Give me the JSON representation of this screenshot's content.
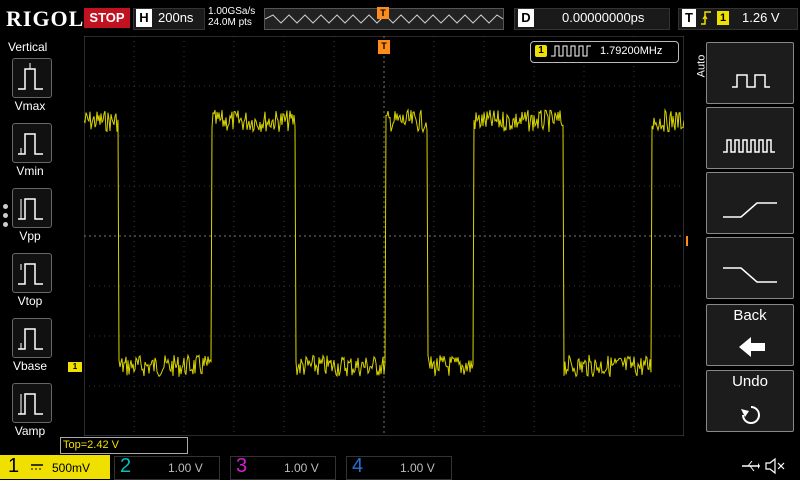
{
  "header": {
    "brand": "RIGOL",
    "run_state": "STOP",
    "h_label": "H",
    "timebase": "200ns",
    "sample_rate": "1.00GSa/s",
    "memory_depth": "24.0M pts",
    "d_label": "D",
    "delay": "0.00000000ps",
    "t_label": "T",
    "trigger_channel": "1",
    "trigger_level": "1.26 V",
    "trigger_marker": "T"
  },
  "left_menu": {
    "title": "Vertical",
    "items": [
      {
        "label": "Vmax"
      },
      {
        "label": "Vmin"
      },
      {
        "label": "Vpp"
      },
      {
        "label": "Vtop"
      },
      {
        "label": "Vbase"
      },
      {
        "label": "Vamp"
      }
    ]
  },
  "measurement": {
    "channel": "1",
    "frequency": "1.79200MHz",
    "readout": "Top=2.42 V",
    "trigger_level_marker": "T",
    "ch1_ground_marker": "1"
  },
  "right_menu": {
    "mode": "Auto",
    "buttons": [
      {
        "name": "square-wave"
      },
      {
        "name": "multi-period"
      },
      {
        "name": "rising-edge"
      },
      {
        "name": "falling-edge"
      }
    ],
    "back_label": "Back",
    "undo_label": "Undo"
  },
  "channels": [
    {
      "num": "1",
      "scale": "500mV",
      "color": "#f0e000"
    },
    {
      "num": "2",
      "scale": "1.00 V",
      "color": "#00c0c0"
    },
    {
      "num": "3",
      "scale": "1.00 V",
      "color": "#d020d0"
    },
    {
      "num": "4",
      "scale": "1.00 V",
      "color": "#2a6fd0"
    }
  ],
  "status": {
    "usb_icon": "usb-icon",
    "speaker_icon": "speaker-mute-icon"
  },
  "colors": {
    "ch1": "#f0e000",
    "stop": "#c1121f",
    "trigger": "#ff8c1a"
  }
}
